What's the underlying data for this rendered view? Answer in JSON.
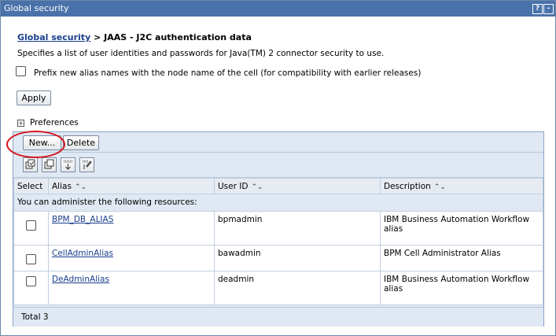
{
  "window": {
    "title": "Global security",
    "help": "?",
    "minimize": "-"
  },
  "breadcrumb": {
    "link": "Global security",
    "rest": " > JAAS - J2C authentication data"
  },
  "description": "Specifies a list of user identities and passwords for Java(TM) 2 connector security to use.",
  "prefix_option": {
    "label": "Prefix new alias names with the node name of the cell (for compatibility with earlier releases)",
    "checked": false
  },
  "apply_label": "Apply",
  "preferences": {
    "expander": "+",
    "label": "Preferences"
  },
  "toolbar": {
    "new_label": "New...",
    "delete_label": "Delete"
  },
  "table": {
    "headers": {
      "select": "Select",
      "alias": "Alias",
      "user_id": "User ID",
      "description": "Description"
    },
    "sort_glyph": "⌃⌄",
    "access_message": "You can administer the following resources:",
    "rows": [
      {
        "alias": "BPM_DB_ALIAS",
        "user_id": "bpmadmin",
        "description": "IBM Business Automation Workflow alias"
      },
      {
        "alias": "CellAdminAlias",
        "user_id": "bawadmin",
        "description": "BPM Cell Administrator Alias"
      },
      {
        "alias": "DeAdminAlias",
        "user_id": "deadmin",
        "description": "IBM Business Automation Workflow alias"
      }
    ],
    "total": "Total 3"
  },
  "colors": {
    "titlebar": "#4a72aa",
    "highlight": "#d6151c",
    "link": "#1a3f8c"
  }
}
